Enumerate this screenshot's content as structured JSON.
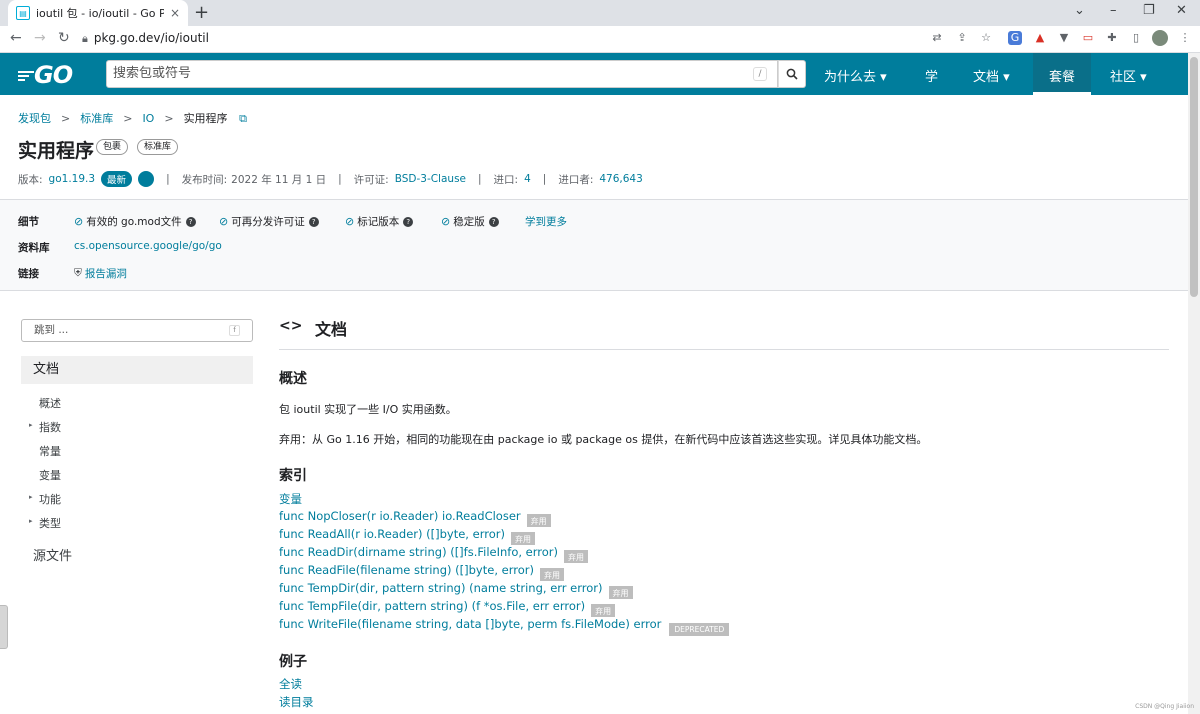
{
  "browser": {
    "tab_title": "ioutil 包 - io/ioutil - Go Package",
    "tab_close": "×",
    "new_tab": "+",
    "url": "pkg.go.dev/io/ioutil",
    "window_controls": [
      "⌄",
      "–",
      "❐",
      "✕"
    ],
    "extension_icons": [
      "translate-icon",
      "share-icon",
      "star-icon",
      "ext-translate-icon",
      "ext-a-icon",
      "ext-v-icon",
      "ext-box-icon",
      "puzzle-icon",
      "sidepanel-icon",
      "avatar-icon",
      "menu-icon"
    ]
  },
  "header": {
    "logo": "GO",
    "search_placeholder": "搜索包或符号",
    "search_shortcut": "/",
    "nav": [
      "为什么去",
      "学",
      "文档",
      "套餐",
      "社区"
    ],
    "active_nav": "套餐",
    "colors": {
      "header_bg": "#007d9c",
      "link": "#007d9c"
    }
  },
  "breadcrumb": [
    "发现包",
    "标准库",
    "IO",
    "实用程序"
  ],
  "title": "实用程序",
  "chips": [
    "包裹",
    "标准库"
  ],
  "meta": {
    "version_label": "版本:",
    "version": "go1.19.3",
    "latest": "最新",
    "published_label": "发布时间:",
    "published": "2022 年 11 月 1 日",
    "license_label": "许可证:",
    "license": "BSD-3-Clause",
    "imports_label": "进口:",
    "imports": "4",
    "importers_label": "进口者:",
    "importers": "476,643"
  },
  "details": {
    "details_label": "细节",
    "checks": [
      "有效的 go.mod文件",
      "可再分发许可证",
      "标记版本",
      "稳定版"
    ],
    "learn_more": "学到更多",
    "repo_label": "资料库",
    "repo": "cs.opensource.google/go/go",
    "links_label": "链接",
    "report": "报告漏洞"
  },
  "sidebar": {
    "jump_placeholder": "跳到 ...",
    "jump_shortcut": "f",
    "active": "文档",
    "items": [
      "概述",
      "指数",
      "常量",
      "变量",
      "功能",
      "类型"
    ],
    "expandable": [
      false,
      true,
      false,
      false,
      true,
      true
    ],
    "source": "源文件"
  },
  "doc": {
    "code_icon": "<>",
    "title": "文档",
    "overview_h": "概述",
    "overview_p1": "包 ioutil 实现了一些 I/O 实用函数。",
    "overview_p2": "弃用：从 Go 1.16 开始，相同的功能现在由 package io 或 package os 提供，在新代码中应该首选这些实现。详见具体功能文档。",
    "index_h": "索引",
    "index_vars": "变量",
    "index": [
      {
        "sig": "func NopCloser(r io.Reader) io.ReadCloser",
        "tag": "弃用"
      },
      {
        "sig": "func ReadAll(r io.Reader) ([]byte, error)",
        "tag": "弃用"
      },
      {
        "sig": "func ReadDir(dirname string) ([]fs.FileInfo, error)",
        "tag": "弃用"
      },
      {
        "sig": "func ReadFile(filename string) ([]byte, error)",
        "tag": "弃用"
      },
      {
        "sig": "func TempDir(dir, pattern string) (name string, err error)",
        "tag": "弃用"
      },
      {
        "sig": "func TempFile(dir, pattern string) (f *os.File, err error)",
        "tag": "弃用"
      },
      {
        "sig": "func WriteFile(filename string, data []byte, perm fs.FileMode) error",
        "tag": "DEPRECATED"
      }
    ],
    "examples_h": "例子",
    "examples": [
      "全读",
      "读目录"
    ]
  },
  "watermark": "CSDN @Qing Jiaiion"
}
